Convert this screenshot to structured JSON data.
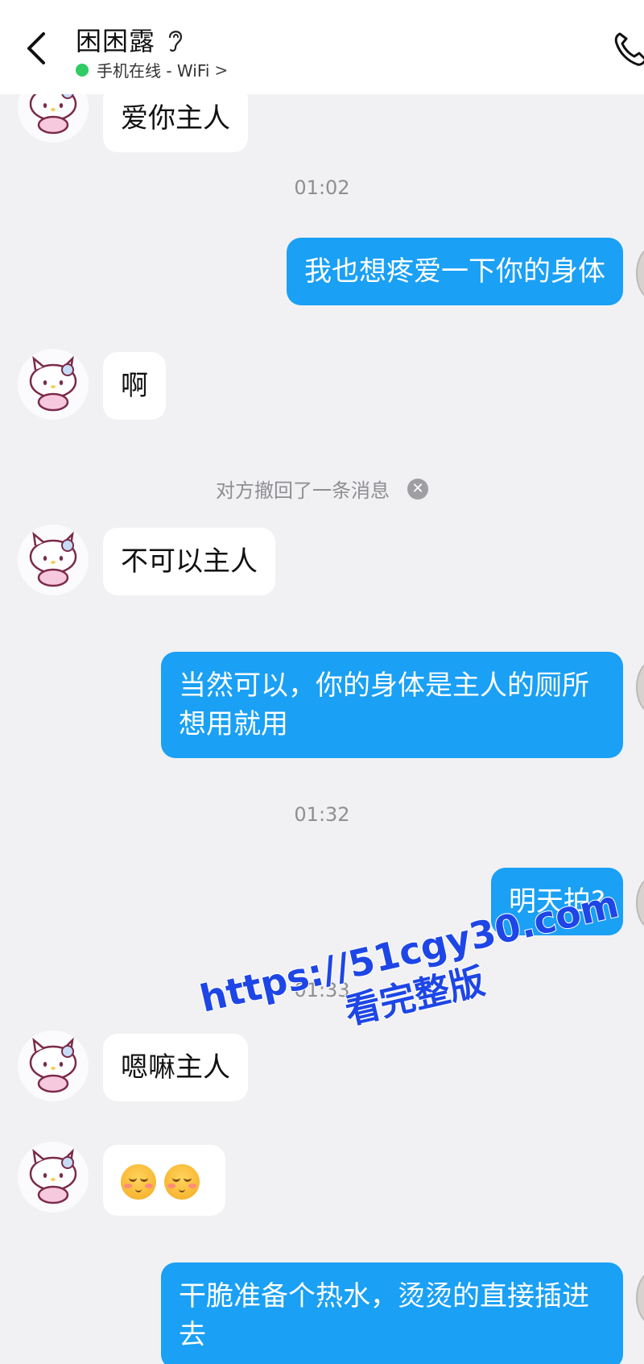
{
  "header": {
    "title": "困困露",
    "status": "手机在线 - WiFi",
    "status_chevron": ">",
    "colors": {
      "online": "#2fcc66"
    }
  },
  "messages": [
    {
      "side": "left",
      "text": "爱你主人"
    },
    {
      "type": "time",
      "text": "01:02"
    },
    {
      "side": "right",
      "text": "我也想疼爱一下你的身体"
    },
    {
      "side": "left",
      "text": "啊"
    },
    {
      "type": "recall",
      "text": "对方撤回了一条消息"
    },
    {
      "side": "left",
      "text": "不可以主人"
    },
    {
      "side": "right",
      "text": "当然可以，你的身体是主人的厕所想用就用"
    },
    {
      "type": "time",
      "text": "01:32"
    },
    {
      "side": "right",
      "text": "明天拍?"
    },
    {
      "type": "time",
      "text": "01:33"
    },
    {
      "side": "left",
      "text": "嗯嘛主人"
    },
    {
      "side": "left",
      "emoji": [
        "blush-smile-emoji",
        "blush-smile-emoji"
      ]
    },
    {
      "side": "right",
      "text": "干脆准备个热水，烫烫的直接插进去"
    }
  ],
  "watermark": {
    "url": "https://51cgy30.com",
    "sub": "看完整版"
  },
  "colors": {
    "right_bubble": "#1aa0f5",
    "left_bubble": "#ffffff",
    "background": "#f1f1f3",
    "watermark": "#1e46e6"
  }
}
